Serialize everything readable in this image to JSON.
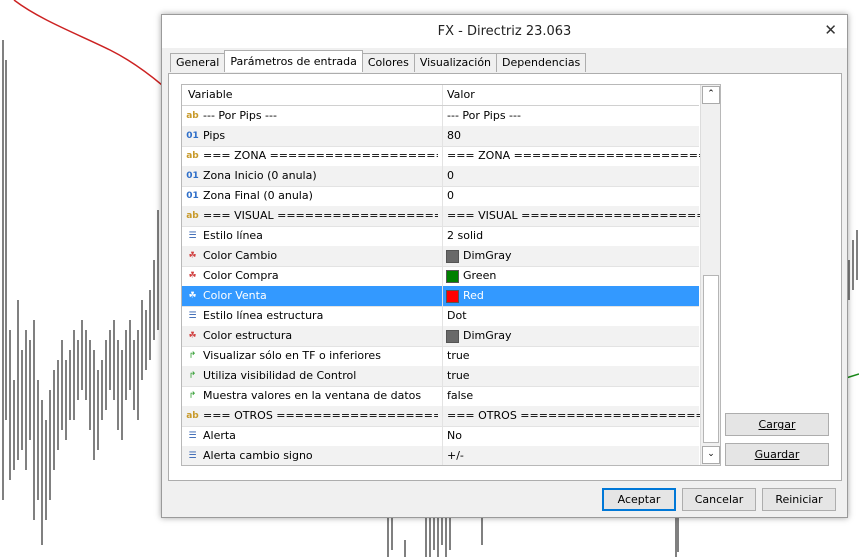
{
  "dialog": {
    "title": "FX - Directriz 23.063",
    "close_glyph": "✕"
  },
  "tabs": [
    {
      "label": "General"
    },
    {
      "label": "Parámetros de entrada"
    },
    {
      "label": "Colores"
    },
    {
      "label": "Visualización"
    },
    {
      "label": "Dependencias"
    }
  ],
  "grid": {
    "headers": {
      "variable": "Variable",
      "value": "Valor"
    },
    "rows": [
      {
        "icon": "string-icon",
        "glyph": "ab",
        "name": "--- Por Pips ---",
        "value": "--- Por Pips ---"
      },
      {
        "icon": "integer-icon",
        "glyph": "01",
        "name": "Pips",
        "value": "80"
      },
      {
        "icon": "string-icon",
        "glyph": "ab",
        "name": "=== ZONA =========================...",
        "value": "=== ZONA =========================..."
      },
      {
        "icon": "integer-icon",
        "glyph": "01",
        "name": "Zona Inicio (0 anula)",
        "value": "0"
      },
      {
        "icon": "integer-icon",
        "glyph": "01",
        "name": "Zona Final (0 anula)",
        "value": "0"
      },
      {
        "icon": "string-icon",
        "glyph": "ab",
        "name": "=== VISUAL =========================...",
        "value": "=== VISUAL =========================..."
      },
      {
        "icon": "list-icon",
        "glyph": "☰",
        "name": "Estilo línea",
        "value": "2 solid"
      },
      {
        "icon": "color-icon",
        "glyph": "☘",
        "name": "Color Cambio",
        "value": "DimGray",
        "swatch": "#696969"
      },
      {
        "icon": "color-icon",
        "glyph": "☘",
        "name": "Color Compra",
        "value": "Green",
        "swatch": "#008000"
      },
      {
        "icon": "color-icon",
        "glyph": "☘",
        "name": "Color Venta",
        "value": "Red",
        "swatch": "#ff0000",
        "selected": true
      },
      {
        "icon": "list-icon",
        "glyph": "☰",
        "name": "Estilo línea estructura",
        "value": "Dot"
      },
      {
        "icon": "color-icon",
        "glyph": "☘",
        "name": "Color estructura",
        "value": "DimGray",
        "swatch": "#696969"
      },
      {
        "icon": "bool-icon",
        "glyph": "↱",
        "name": "Visualizar sólo en TF o inferiores",
        "value": "true"
      },
      {
        "icon": "bool-icon",
        "glyph": "↱",
        "name": "Utiliza visibilidad de Control",
        "value": "true"
      },
      {
        "icon": "bool-icon",
        "glyph": "↱",
        "name": "Muestra valores en la ventana de datos",
        "value": "false"
      },
      {
        "icon": "string-icon",
        "glyph": "ab",
        "name": "=== OTROS =========================...",
        "value": "=== OTROS =========================..."
      },
      {
        "icon": "list-icon",
        "glyph": "☰",
        "name": "Alerta",
        "value": "No"
      },
      {
        "icon": "list-icon",
        "glyph": "☰",
        "name": "Alerta cambio signo",
        "value": "+/-"
      }
    ]
  },
  "side_buttons": {
    "load": "Cargar",
    "save": "Guardar"
  },
  "footer_buttons": {
    "ok": "Aceptar",
    "cancel": "Cancelar",
    "reset": "Reiniciar"
  },
  "colors": {
    "selection": "#3399ff",
    "chart_line": "#cc2222",
    "chart_green": "#1a8a1a"
  }
}
